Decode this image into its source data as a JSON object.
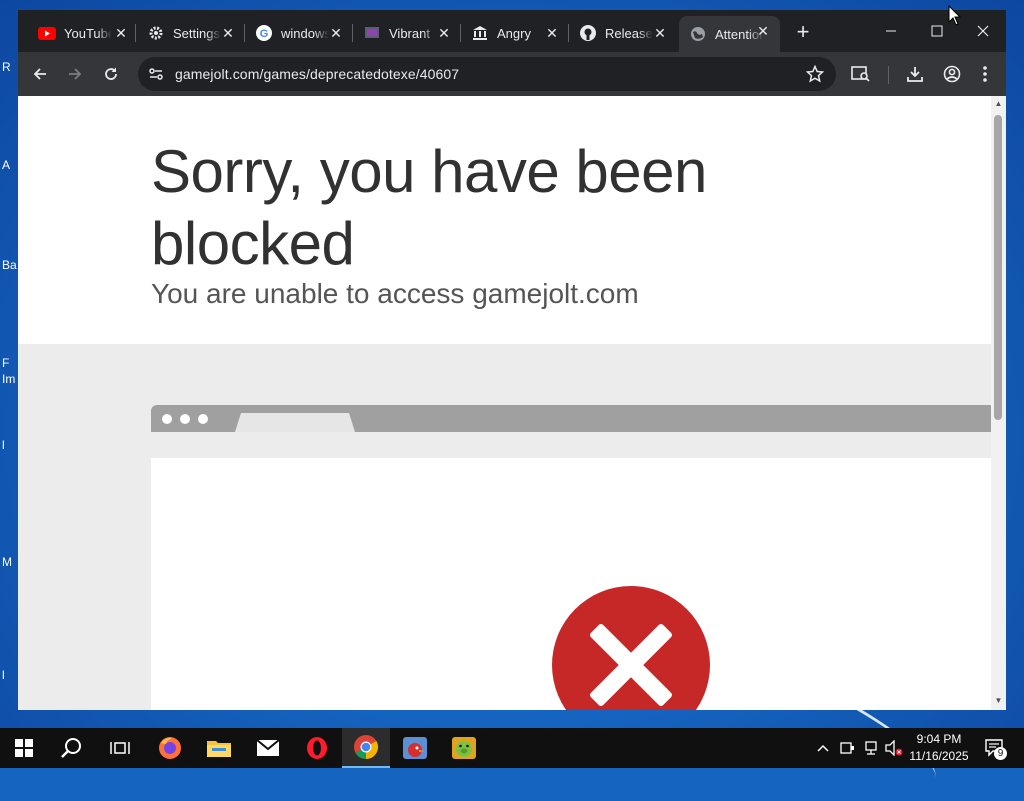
{
  "desktop": {
    "fragments": [
      "R",
      "A",
      "Ba",
      "F",
      "Im",
      "l",
      "M",
      "l"
    ]
  },
  "browser": {
    "tabs": [
      {
        "label": "YouTube",
        "icon": "youtube-icon"
      },
      {
        "label": "Settings",
        "icon": "settings-gear-icon"
      },
      {
        "label": "windows",
        "icon": "google-icon"
      },
      {
        "label": "Vibrant",
        "icon": "page-icon"
      },
      {
        "label": "Angry",
        "icon": "bank-icon"
      },
      {
        "label": "Releases",
        "icon": "github-icon"
      },
      {
        "label": "Attention",
        "icon": "globe-icon",
        "active": true
      }
    ],
    "address_bar": {
      "url": "gamejolt.com/games/deprecatedotexe/40607"
    }
  },
  "page": {
    "headline": "Sorry, you have been blocked",
    "subheadline": "You are unable to access gamejolt.com",
    "error_color": "#c62828"
  },
  "taskbar": {
    "time": "9:04 PM",
    "date": "11/16/2025",
    "notification_count": "9"
  }
}
